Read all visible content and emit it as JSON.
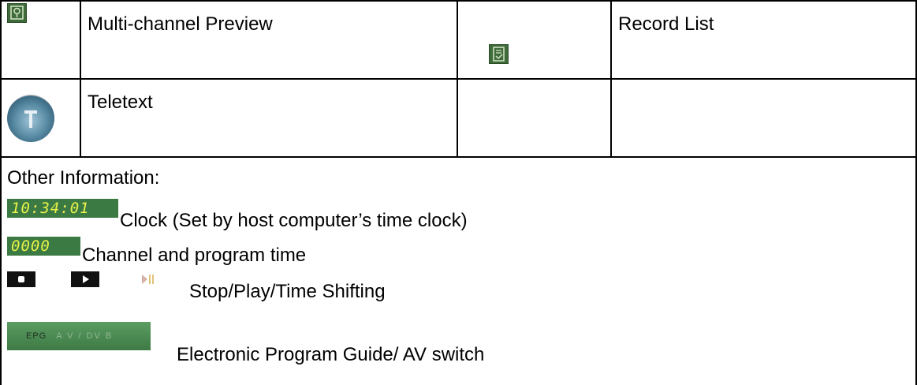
{
  "table": {
    "row1": {
      "left_label": "Multi-channel Preview",
      "right_label": "Record List"
    },
    "row2": {
      "left_label": "Teletext"
    }
  },
  "other": {
    "heading": "Other Information:",
    "clock": {
      "display": {
        "h": "10",
        "m": "34",
        "s": "01"
      },
      "label": "Clock (Set by host computer’s time clock)"
    },
    "channel": {
      "display": "0000",
      "label": "Channel and program time"
    },
    "playback": {
      "label": "Stop/Play/Time Shifting"
    },
    "epg": {
      "button_left": "EPG",
      "button_right": "A V / DV B",
      "label": "Electronic Program Guide/ AV switch"
    }
  },
  "colors": {
    "lcd_bg": "#3c7a43",
    "lcd_digits": "#e8f24a",
    "icon_green": "#3f6b3a"
  }
}
